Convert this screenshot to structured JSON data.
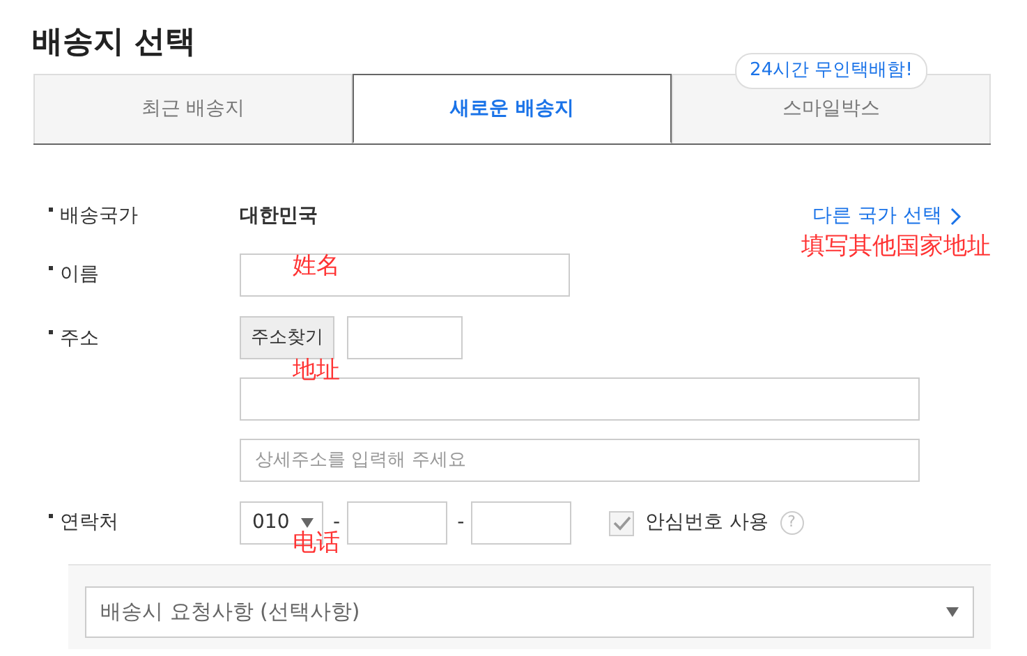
{
  "title": "배송지 선택",
  "tabs": [
    {
      "label": "최근 배송지",
      "selected": false
    },
    {
      "label": "새로운 배송지",
      "selected": true
    },
    {
      "label": "스마일박스",
      "selected": false,
      "tooltip": "24시간 무인택배함!"
    }
  ],
  "rows": [
    {
      "kind": "text",
      "label": "배송국가",
      "value": "대한민국",
      "link": "다른 국가 선택"
    },
    {
      "kind": "input",
      "label": "이름"
    },
    {
      "kind": "address",
      "label": "주소",
      "button": "주소찾기",
      "placeholder": "상세주소를 입력해 주세요"
    },
    {
      "kind": "phone",
      "label": "연락처",
      "prefix": "010",
      "separators": [
        "-",
        "-"
      ],
      "checkbox": {
        "label": "안심번호 사용",
        "checked": true
      },
      "help": "?"
    }
  ],
  "request_select": "배송시 요청사항 (선택사항)",
  "annotations": {
    "other_country": "填写其他国家地址",
    "name": "姓名",
    "address": "地址",
    "phone": "电话"
  }
}
